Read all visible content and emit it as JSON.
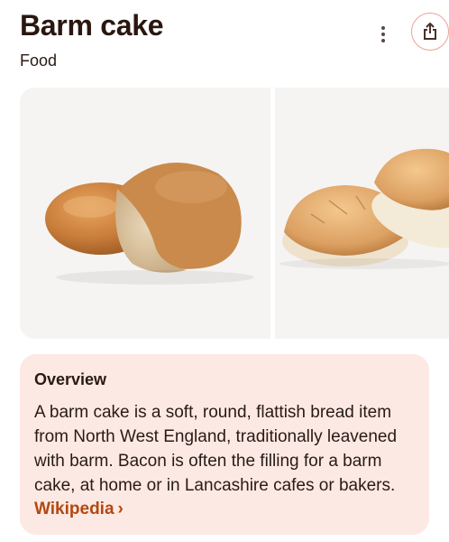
{
  "header": {
    "title": "Barm cake",
    "subtitle": "Food"
  },
  "gallery": {
    "images": [
      {
        "alt": "Barm cake cut in half"
      },
      {
        "alt": "Two barm cakes"
      }
    ]
  },
  "overview": {
    "heading": "Overview",
    "text": "A barm cake is a soft, round, flattish bread item from North West England, traditionally leavened with barm. Bacon is often the filling for a barm cake, at home or in Lancashire cafes or bakers.",
    "link_label": "Wikipedia",
    "link_chevron": "›"
  },
  "colors": {
    "accent": "#b2480f",
    "overview_bg": "#fde9e4",
    "share_border": "#e9a497"
  }
}
